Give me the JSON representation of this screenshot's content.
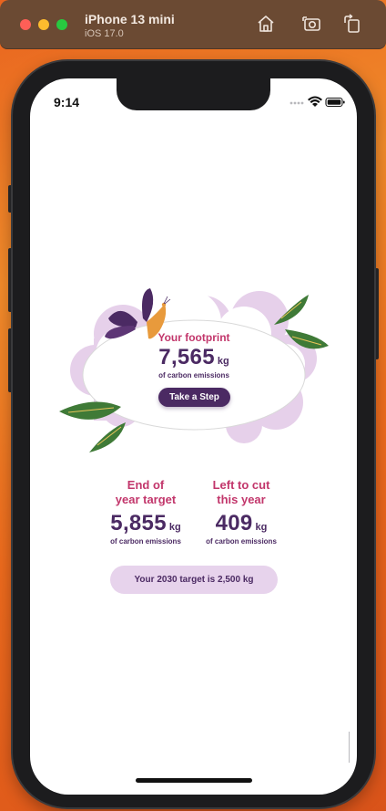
{
  "simulator": {
    "device_name": "iPhone 13 mini",
    "os_version": "iOS 17.0",
    "toolbar_icons": [
      "home-icon",
      "screenshot-icon",
      "rotate-icon"
    ]
  },
  "status_bar": {
    "time": "9:14"
  },
  "footprint": {
    "label": "Your footprint",
    "value": "7,565",
    "unit": "kg",
    "sub": "of carbon emissions",
    "button_label": "Take a Step"
  },
  "stats": [
    {
      "title_line1": "End of",
      "title_line2": "year target",
      "value": "5,855",
      "unit": "kg",
      "sub": "of carbon emissions"
    },
    {
      "title_line1": "Left to cut",
      "title_line2": "this year",
      "value": "409",
      "unit": "kg",
      "sub": "of carbon emissions"
    }
  ],
  "target_pill": "Your 2030 target is 2,500 kg",
  "colors": {
    "accent_pink": "#c2366b",
    "primary_purple": "#4b2a63",
    "pill_lavender": "#e7d3ec",
    "cloud_lavender": "#e6d0ea",
    "leaf_green": "#3f7a37",
    "butterfly_orange": "#e89a3c"
  }
}
